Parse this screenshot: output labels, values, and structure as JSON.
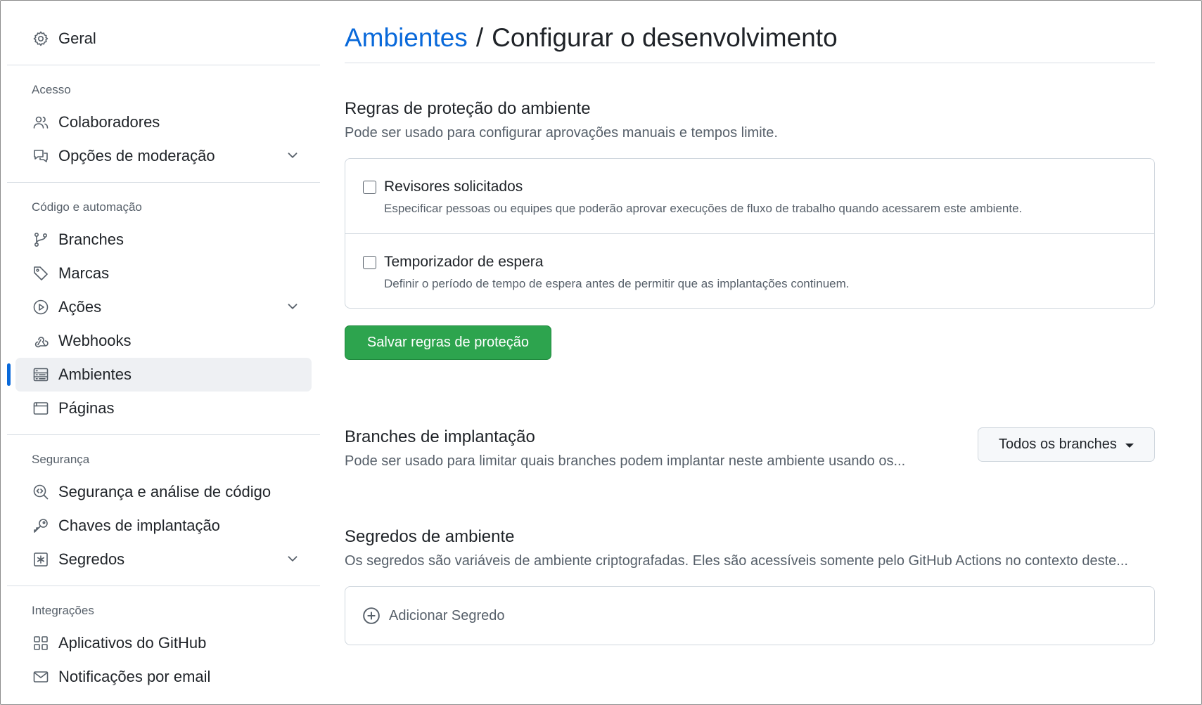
{
  "sidebar": {
    "general": {
      "label": "Geral"
    },
    "access": {
      "heading": "Acesso",
      "items": [
        {
          "label": "Colaboradores"
        },
        {
          "label": "Opções de moderação"
        }
      ]
    },
    "code": {
      "heading": "Código e automação",
      "items": [
        {
          "label": "Branches"
        },
        {
          "label": "Marcas"
        },
        {
          "label": "Ações"
        },
        {
          "label": "Webhooks"
        },
        {
          "label": "Ambientes"
        },
        {
          "label": "Páginas"
        }
      ]
    },
    "security": {
      "heading": "Segurança",
      "items": [
        {
          "label": "Segurança e análise de código"
        },
        {
          "label": "Chaves de implantação"
        },
        {
          "label": "Segredos"
        }
      ]
    },
    "integrations": {
      "heading": "Integrações",
      "items": [
        {
          "label": "Aplicativos do GitHub"
        },
        {
          "label": "Notificações por email"
        }
      ]
    }
  },
  "header": {
    "breadcrumb": "Ambientes",
    "separator": "/",
    "title": "Configurar o desenvolvimento"
  },
  "protection": {
    "title": "Regras de proteção do ambiente",
    "description": "Pode ser usado para configurar aprovações manuais e tempos limite.",
    "rules": [
      {
        "title": "Revisores solicitados",
        "description": "Especificar pessoas ou equipes que poderão aprovar execuções de fluxo de trabalho quando acessarem este ambiente."
      },
      {
        "title": "Temporizador de espera",
        "description": "Definir o período de tempo de espera antes de permitir que as implantações continuem."
      }
    ],
    "save_label": "Salvar regras de proteção"
  },
  "branches": {
    "title": "Branches de implantação",
    "description": "Pode ser usado para limitar quais branches podem implantar neste ambiente usando os...",
    "dropdown_label": "Todos os branches"
  },
  "secrets": {
    "title": "Segredos de ambiente",
    "description": "Os segredos são variáveis de ambiente criptografadas. Eles são acessíveis somente pelo GitHub Actions no contexto deste...",
    "add_label": "Adicionar Segredo"
  },
  "colors": {
    "accent": "#0969da",
    "primary_button": "#2da44e",
    "active_nav_bg": "#eef0f3"
  }
}
